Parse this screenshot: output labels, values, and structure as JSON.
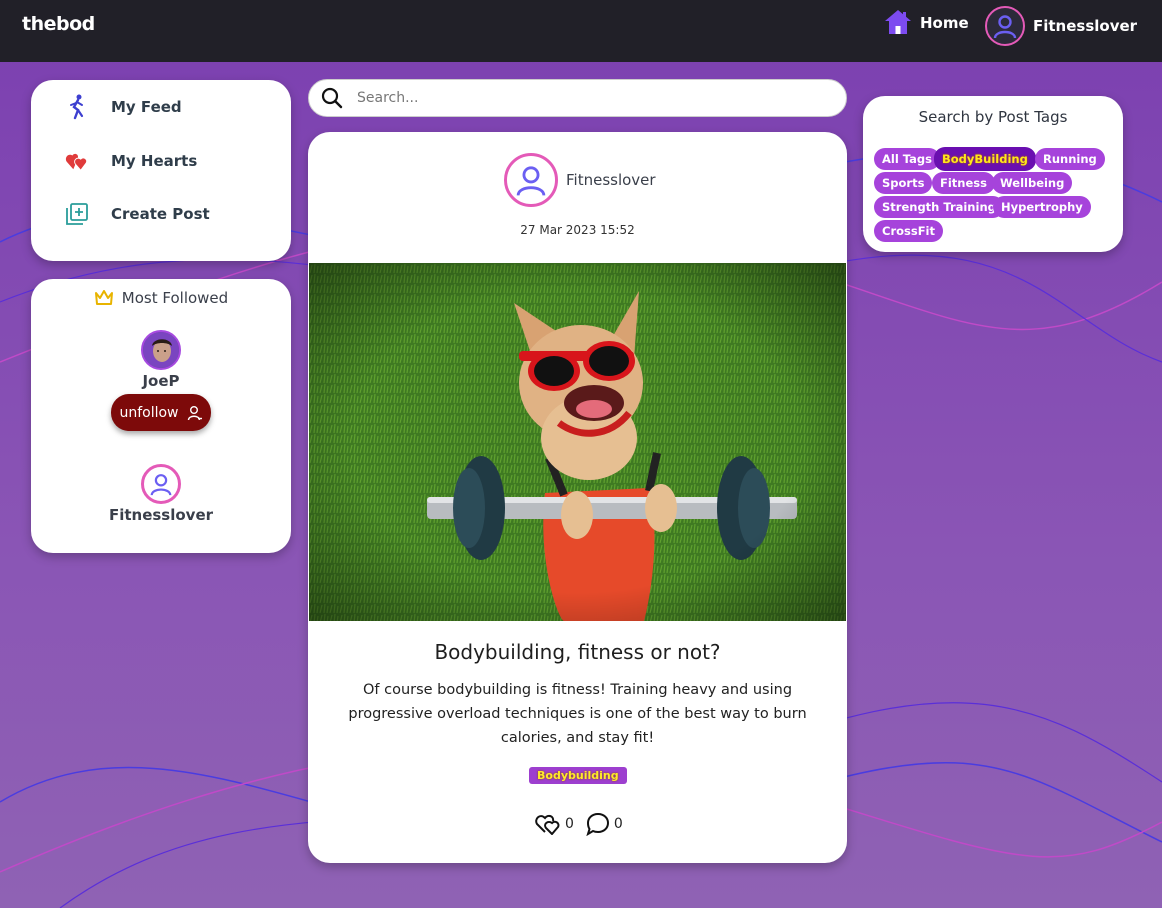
{
  "nav": {
    "logo": "thebod",
    "home_label": "Home",
    "user_label": "Fitnesslover"
  },
  "sidebar": {
    "items": [
      {
        "label": "My Feed",
        "icon": "runner-icon"
      },
      {
        "label": "My Hearts",
        "icon": "hearts-icon"
      },
      {
        "label": "Create Post",
        "icon": "add-post-icon"
      }
    ]
  },
  "most_followed": {
    "title": "Most Followed",
    "users": [
      {
        "name": "JoeP",
        "button_label": "unfollow"
      },
      {
        "name": "Fitnesslover"
      }
    ]
  },
  "search": {
    "placeholder": "Search...",
    "value": ""
  },
  "post": {
    "author": "Fitnesslover",
    "date": "27 Mar 2023 15:52",
    "title": "Bodybuilding, fitness or not?",
    "body": "Of course bodybuilding is fitness! Training heavy and using progressive overload techniques is one of the best way to burn calories, and stay fit!",
    "tag": "Bodybuilding",
    "hearts_count": "0",
    "comments_count": "0"
  },
  "tags_panel": {
    "title": "Search by Post Tags",
    "tags": [
      {
        "label": "All Tags",
        "active": false
      },
      {
        "label": "BodyBuilding",
        "active": true
      },
      {
        "label": "Running",
        "active": false
      },
      {
        "label": "Sports",
        "active": false
      },
      {
        "label": "Fitness",
        "active": false
      },
      {
        "label": "Wellbeing",
        "active": false
      },
      {
        "label": "Strength Training",
        "active": false
      },
      {
        "label": "Hypertrophy",
        "active": false
      },
      {
        "label": "CrossFit",
        "active": false
      }
    ]
  },
  "colors": {
    "navbar": "#212028",
    "background": "#7b3fb0",
    "accent": "#a643db",
    "unfollow": "#7d0a0a",
    "avatar_ring": "#e45ab8"
  }
}
